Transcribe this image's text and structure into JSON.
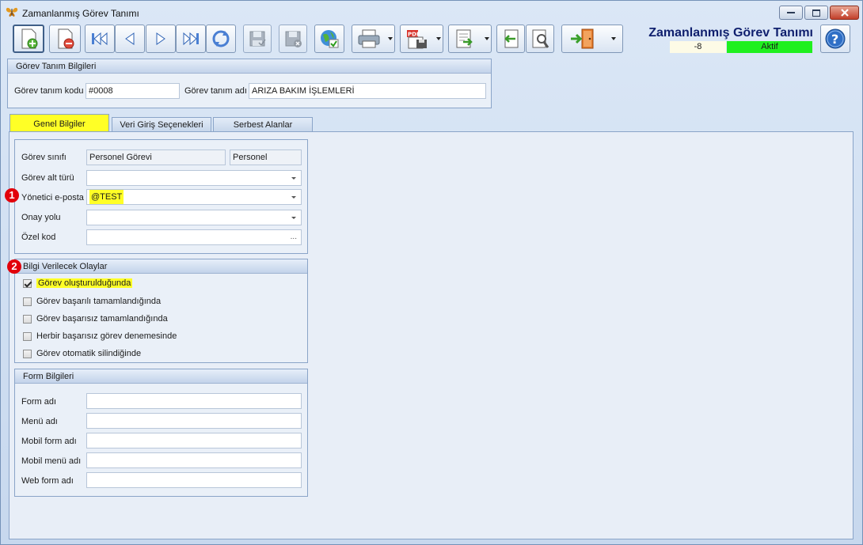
{
  "window": {
    "title": "Zamanlanmış Görev Tanımı"
  },
  "header": {
    "title": "Zamanlanmış Görev Tanımı",
    "number": "-8",
    "status": "Aktif",
    "status_color": "#1ff01f"
  },
  "toolbar": {
    "buttons": [
      {
        "icon": "new-document-icon"
      },
      {
        "icon": "delete-document-icon"
      },
      {
        "icon": "first-record-icon"
      },
      {
        "icon": "previous-record-icon"
      },
      {
        "icon": "next-record-icon"
      },
      {
        "icon": "last-record-icon"
      },
      {
        "icon": "refresh-icon"
      },
      {
        "icon": "save-icon"
      },
      {
        "icon": "save-cancel-icon"
      },
      {
        "icon": "globe-check-icon"
      },
      {
        "icon": "print-icon"
      },
      {
        "icon": "pdf-export-icon"
      },
      {
        "icon": "export-icon"
      },
      {
        "icon": "import-icon"
      },
      {
        "icon": "tools-icon"
      },
      {
        "icon": "exit-door-icon"
      }
    ]
  },
  "definition": {
    "group_title": "Görev Tanım Bilgileri",
    "code_label": "Görev tanım kodu",
    "code_value": "#0008",
    "name_label": "Görev tanım adı",
    "name_value": "ARIZA BAKIM İŞLEMLERİ"
  },
  "tabs": [
    "Genel Bilgiler",
    "Veri Giriş Seçenekleri",
    "Serbest Alanlar"
  ],
  "general": {
    "class_label": "Görev sınıfı",
    "class_value": "Personel Görevi",
    "class_value2": "Personel",
    "subtype_label": "Görev alt türü",
    "subtype_value": "",
    "email_label": "Yönetici e-posta",
    "email_value": "@TEST",
    "approval_label": "Onay yolu",
    "approval_value": "",
    "special_label": "Özel kod",
    "special_value": "",
    "special_dots": "..."
  },
  "markers": [
    "1",
    "2"
  ],
  "events": {
    "group_title": "Bilgi Verilecek Olaylar",
    "items": [
      {
        "label": "Görev oluşturulduğunda",
        "checked": true
      },
      {
        "label": "Görev başarılı tamamlandığında",
        "checked": false
      },
      {
        "label": "Görev başarısız tamamlandığında",
        "checked": false
      },
      {
        "label": "Herbir başarısız görev denemesinde",
        "checked": false
      },
      {
        "label": "Görev otomatik silindiğinde",
        "checked": false
      }
    ]
  },
  "form": {
    "group_title": "Form Bilgileri",
    "form_name_label": "Form adı",
    "form_name_value": "",
    "menu_name_label": "Menü adı",
    "menu_name_value": "",
    "mobile_form_label": "Mobil form adı",
    "mobile_form_value": "",
    "mobile_menu_label": "Mobil menü adı",
    "mobile_menu_value": "",
    "web_form_label": "Web form adı",
    "web_form_value": ""
  },
  "colors": {
    "highlight": "#ffff26",
    "marker": "#e2000a",
    "header_title": "#0f1f6e"
  }
}
